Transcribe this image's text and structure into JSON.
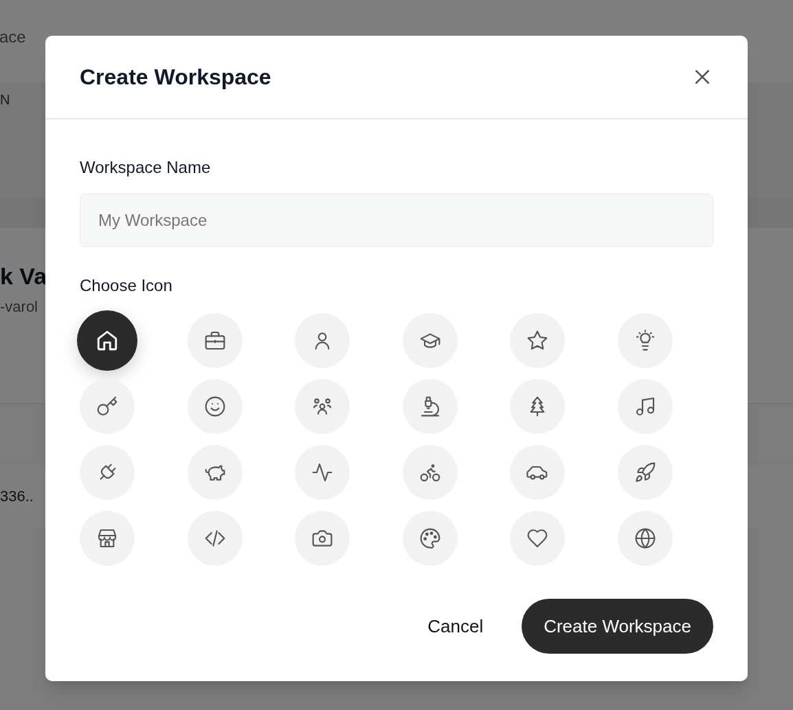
{
  "background": {
    "subtitle": "ace",
    "column_label": "N",
    "profile_name": "k Va",
    "profile_handle": "-varol",
    "id_value": "336.."
  },
  "dialog": {
    "title": "Create Workspace",
    "name_field": {
      "label": "Workspace Name",
      "placeholder": "My Workspace"
    },
    "icon_label": "Choose Icon",
    "icons": [
      {
        "selected": true
      },
      {
        "selected": false
      },
      {
        "selected": false
      },
      {
        "selected": false
      },
      {
        "selected": false
      },
      {
        "selected": false
      },
      {
        "selected": false
      },
      {
        "selected": false
      },
      {
        "selected": false
      },
      {
        "selected": false
      },
      {
        "selected": false
      },
      {
        "selected": false
      },
      {
        "selected": false
      },
      {
        "selected": false
      },
      {
        "selected": false
      },
      {
        "selected": false
      },
      {
        "selected": false
      },
      {
        "selected": false
      },
      {
        "selected": false
      },
      {
        "selected": false
      },
      {
        "selected": false
      },
      {
        "selected": false
      },
      {
        "selected": false
      },
      {
        "selected": false
      }
    ],
    "buttons": {
      "cancel": "Cancel",
      "create": "Create Workspace"
    }
  }
}
